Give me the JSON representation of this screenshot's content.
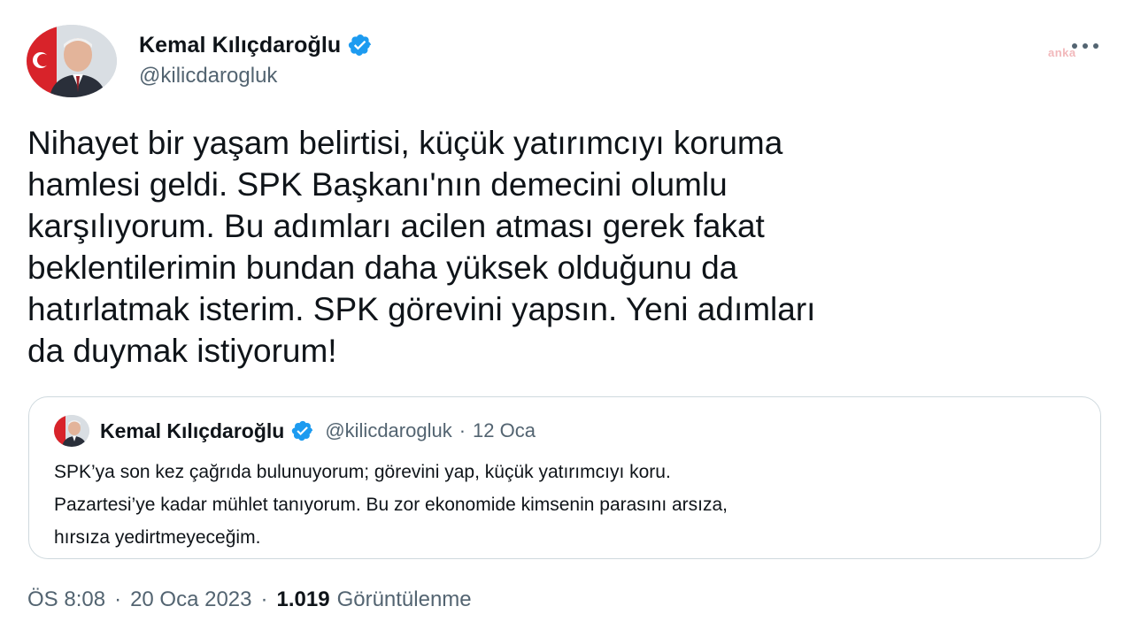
{
  "author": {
    "display_name": "Kemal Kılıçdaroğlu",
    "handle": "@kilicdarogluk",
    "verified": true
  },
  "watermark": "anka",
  "tweet": {
    "text": "Nihayet bir yaşam belirtisi, küçük yatırımcıyı koruma\nhamlesi geldi. SPK Başkanı'nın demecini olumlu\nkarşılıyorum. Bu adımları acilen atması gerek fakat\nbeklentilerimin bundan daha yüksek olduğunu da\nhatırlatmak isterim. SPK görevini yapsın. Yeni adımları\nda duymak istiyorum!",
    "time": "ÖS 8:08",
    "date": "20 Oca 2023",
    "separator": "·",
    "views_count": "1.019",
    "views_label": "Görüntülenme"
  },
  "quoted_tweet": {
    "display_name": "Kemal Kılıçdaroğlu",
    "handle": "@kilicdarogluk",
    "separator": "·",
    "date": "12 Oca",
    "text": "SPK’ya son kez çağrıda bulunuyorum; görevini yap, küçük yatırımcıyı koru.\nPazartesi’ye kadar mühlet tanıyorum. Bu zor ekonomide kimsenin parasını arsıza,\nhırsıza yedirtmeyeceğim."
  },
  "colors": {
    "verified_blue": "#1d9bf0",
    "secondary_text": "#536471",
    "border": "#cfd9de"
  },
  "icons": {
    "verified": "verified-badge-icon",
    "more": "more-dots-icon"
  }
}
